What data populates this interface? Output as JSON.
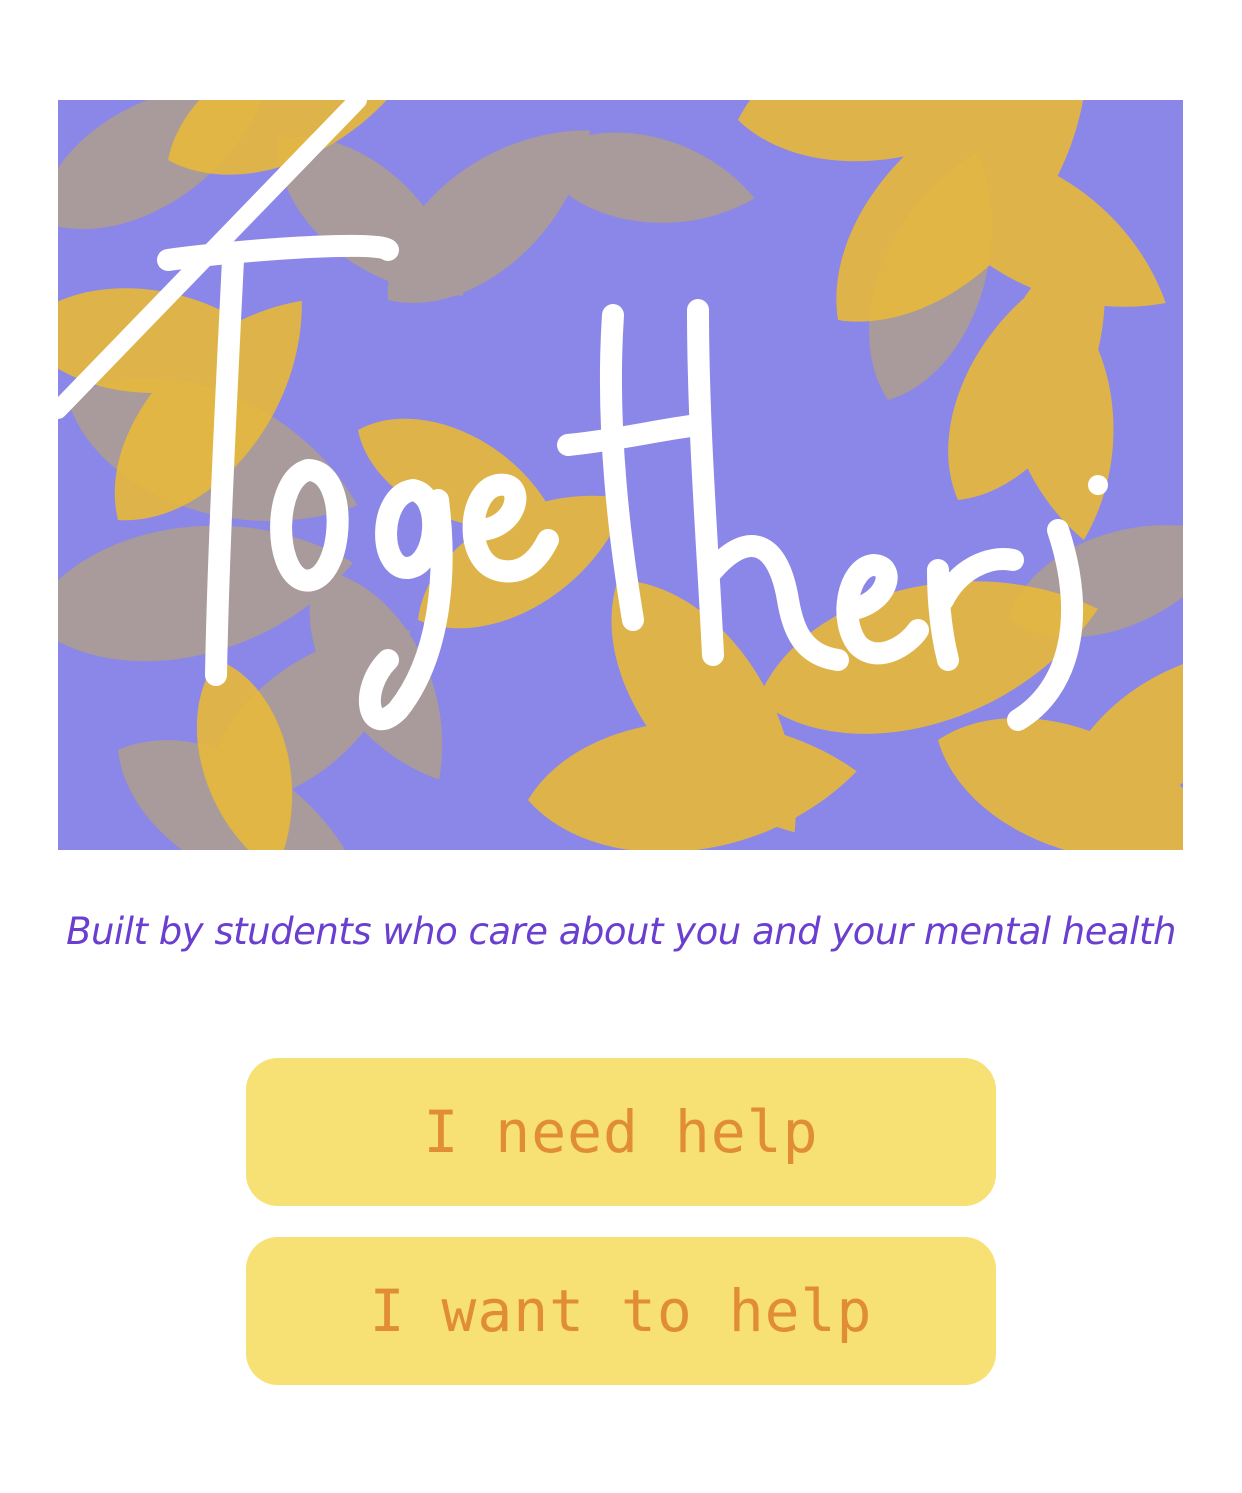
{
  "hero": {
    "logo_text": "Together",
    "colors": {
      "background": "#8a87e8",
      "leaf_gold": "#e6b93d",
      "leaf_muted": "#b3a082",
      "script": "#ffffff"
    }
  },
  "tagline": "Built by students who care about you and your mental health",
  "buttons": {
    "need_help": "I need help",
    "want_to_help": "I want to help"
  },
  "colors": {
    "tagline": "#6a3fd0",
    "button_bg": "#f7e074",
    "button_text": "#e08d35"
  }
}
